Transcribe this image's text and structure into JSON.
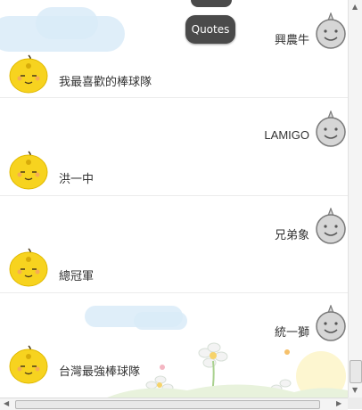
{
  "quotes_button": {
    "label": "Quotes"
  },
  "messages": [
    {
      "bot_text": "興農牛",
      "user_text": "我最喜歡的棒球隊"
    },
    {
      "bot_text": "LAMIGO",
      "user_text": "洪一中"
    },
    {
      "bot_text": "兄弟象",
      "user_text": "總冠軍"
    },
    {
      "bot_text": "統一獅",
      "user_text": "台灣最強棒球隊"
    }
  ],
  "icons": {
    "bot_avatar": "gray-smiley-face-icon",
    "user_avatar": "yellow-smiley-face-icon",
    "scroll_up": "triangle-up-icon",
    "scroll_down": "triangle-down-icon",
    "scroll_left": "triangle-left-icon",
    "scroll_right": "triangle-right-icon"
  },
  "colors": {
    "user_face": "#f7d31f",
    "bot_face": "#d6d6d6",
    "quotes_button": "#4a4a4a",
    "cloud": "#d9ebf8"
  }
}
